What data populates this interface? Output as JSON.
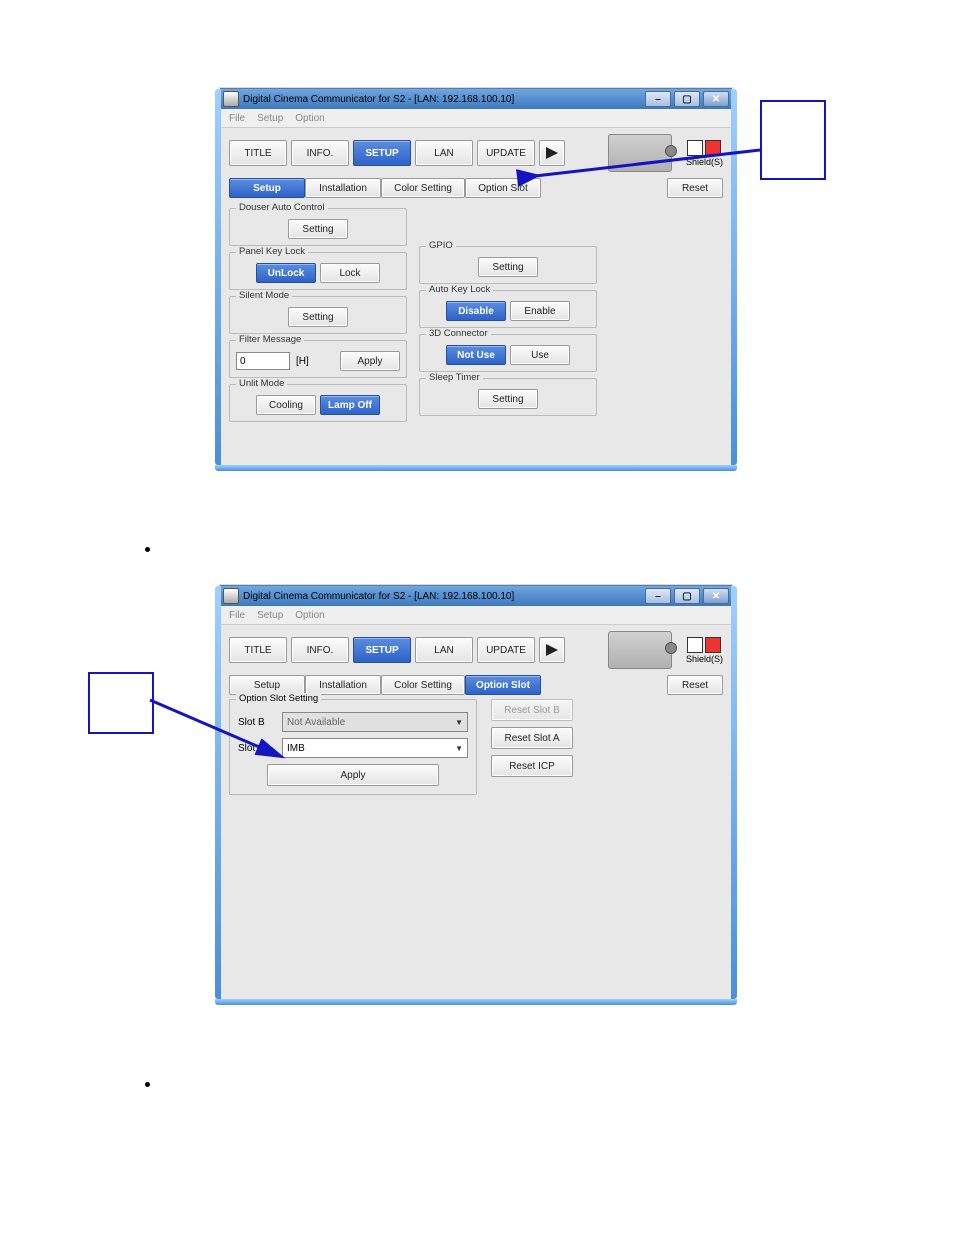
{
  "window_title": "Digital Cinema Communicator for S2 - [LAN: 192.168.100.10]",
  "menu": {
    "file": "File",
    "setup": "Setup",
    "option": "Option"
  },
  "nav": {
    "title": "TITLE",
    "info": "INFO.",
    "setup": "SETUP",
    "lan": "LAN",
    "update": "UPDATE"
  },
  "shield_label": "Shield(S)",
  "subtabs": {
    "setup": "Setup",
    "installation": "Installation",
    "color": "Color Setting",
    "option_slot": "Option Slot",
    "reset": "Reset"
  },
  "groups": {
    "douser": {
      "legend": "Douser Auto Control",
      "setting": "Setting"
    },
    "panel_key": {
      "legend": "Panel Key Lock",
      "unlock": "UnLock",
      "lock": "Lock"
    },
    "silent": {
      "legend": "Silent Mode",
      "setting": "Setting"
    },
    "filter": {
      "legend": "Filter Message",
      "value": "0",
      "unit": "[H]",
      "apply": "Apply"
    },
    "unlit": {
      "legend": "Unlit Mode",
      "cooling": "Cooling",
      "lampoff": "Lamp Off"
    },
    "gpio": {
      "legend": "GPIO",
      "setting": "Setting"
    },
    "autokey": {
      "legend": "Auto Key Lock",
      "disable": "Disable",
      "enable": "Enable"
    },
    "threed": {
      "legend": "3D Connector",
      "notuse": "Not Use",
      "use": "Use"
    },
    "sleep": {
      "legend": "Sleep Timer",
      "setting": "Setting"
    }
  },
  "option_slot_panel": {
    "legend": "Option Slot Setting",
    "slot_b_label": "Slot B",
    "slot_b_value": "Not Available",
    "slot_a_label": "Slot A",
    "slot_a_value": "IMB",
    "apply": "Apply",
    "reset_b": "Reset Slot B",
    "reset_a": "Reset Slot A",
    "reset_icp": "Reset ICP"
  }
}
